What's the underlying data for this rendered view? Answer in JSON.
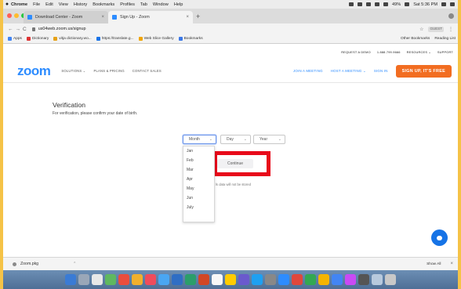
{
  "menubar": {
    "app": "Chrome",
    "items": [
      "File",
      "Edit",
      "View",
      "History",
      "Bookmarks",
      "Profiles",
      "Tab",
      "Window",
      "Help"
    ],
    "battery": "49%",
    "clock": "Sat 5:36 PM"
  },
  "tabs": [
    {
      "title": "Download Center - Zoom"
    },
    {
      "title": "Sign Up - Zoom"
    }
  ],
  "address": {
    "url": "us04web.zoom.us/signup",
    "badge": "GUEST"
  },
  "bookmarks": {
    "items": [
      "Apps",
      "Dictionary",
      "vitja dictionary.wo...",
      "https://translate.g...",
      "Web Slice Gallery",
      "Bookmarks"
    ],
    "right": [
      "Other Bookmarks",
      "Reading List"
    ]
  },
  "zoom_top": {
    "items": [
      "REQUEST A DEMO",
      "1.888.799.9666",
      "RESOURCES ⌄",
      "SUPPORT"
    ]
  },
  "zoom_nav": {
    "logo": "zoom",
    "left": [
      "SOLUTIONS ⌄",
      "PLANS & PRICING",
      "CONTACT SALES"
    ],
    "right": [
      "JOIN A MEETING",
      "HOST A MEETING ⌄",
      "SIGN IN"
    ],
    "cta": "SIGN UP, IT'S FREE"
  },
  "verification": {
    "title": "Verification",
    "subtitle": "For verification, please confirm your date of birth.",
    "month": "Month",
    "day": "Day",
    "year": "Year",
    "months_visible": [
      "Jan",
      "Feb",
      "Mar",
      "Apr",
      "May",
      "Jun",
      "July"
    ],
    "continue": "Continue",
    "note": "ls data will not be stored"
  },
  "downloads": {
    "file": "Zoom.pkg",
    "show_all": "Show All"
  },
  "colors": {
    "zoom_blue": "#2d8cff",
    "cta_orange": "#f26d21",
    "highlight_red": "#e8091a",
    "page_border": "#f5c347"
  }
}
